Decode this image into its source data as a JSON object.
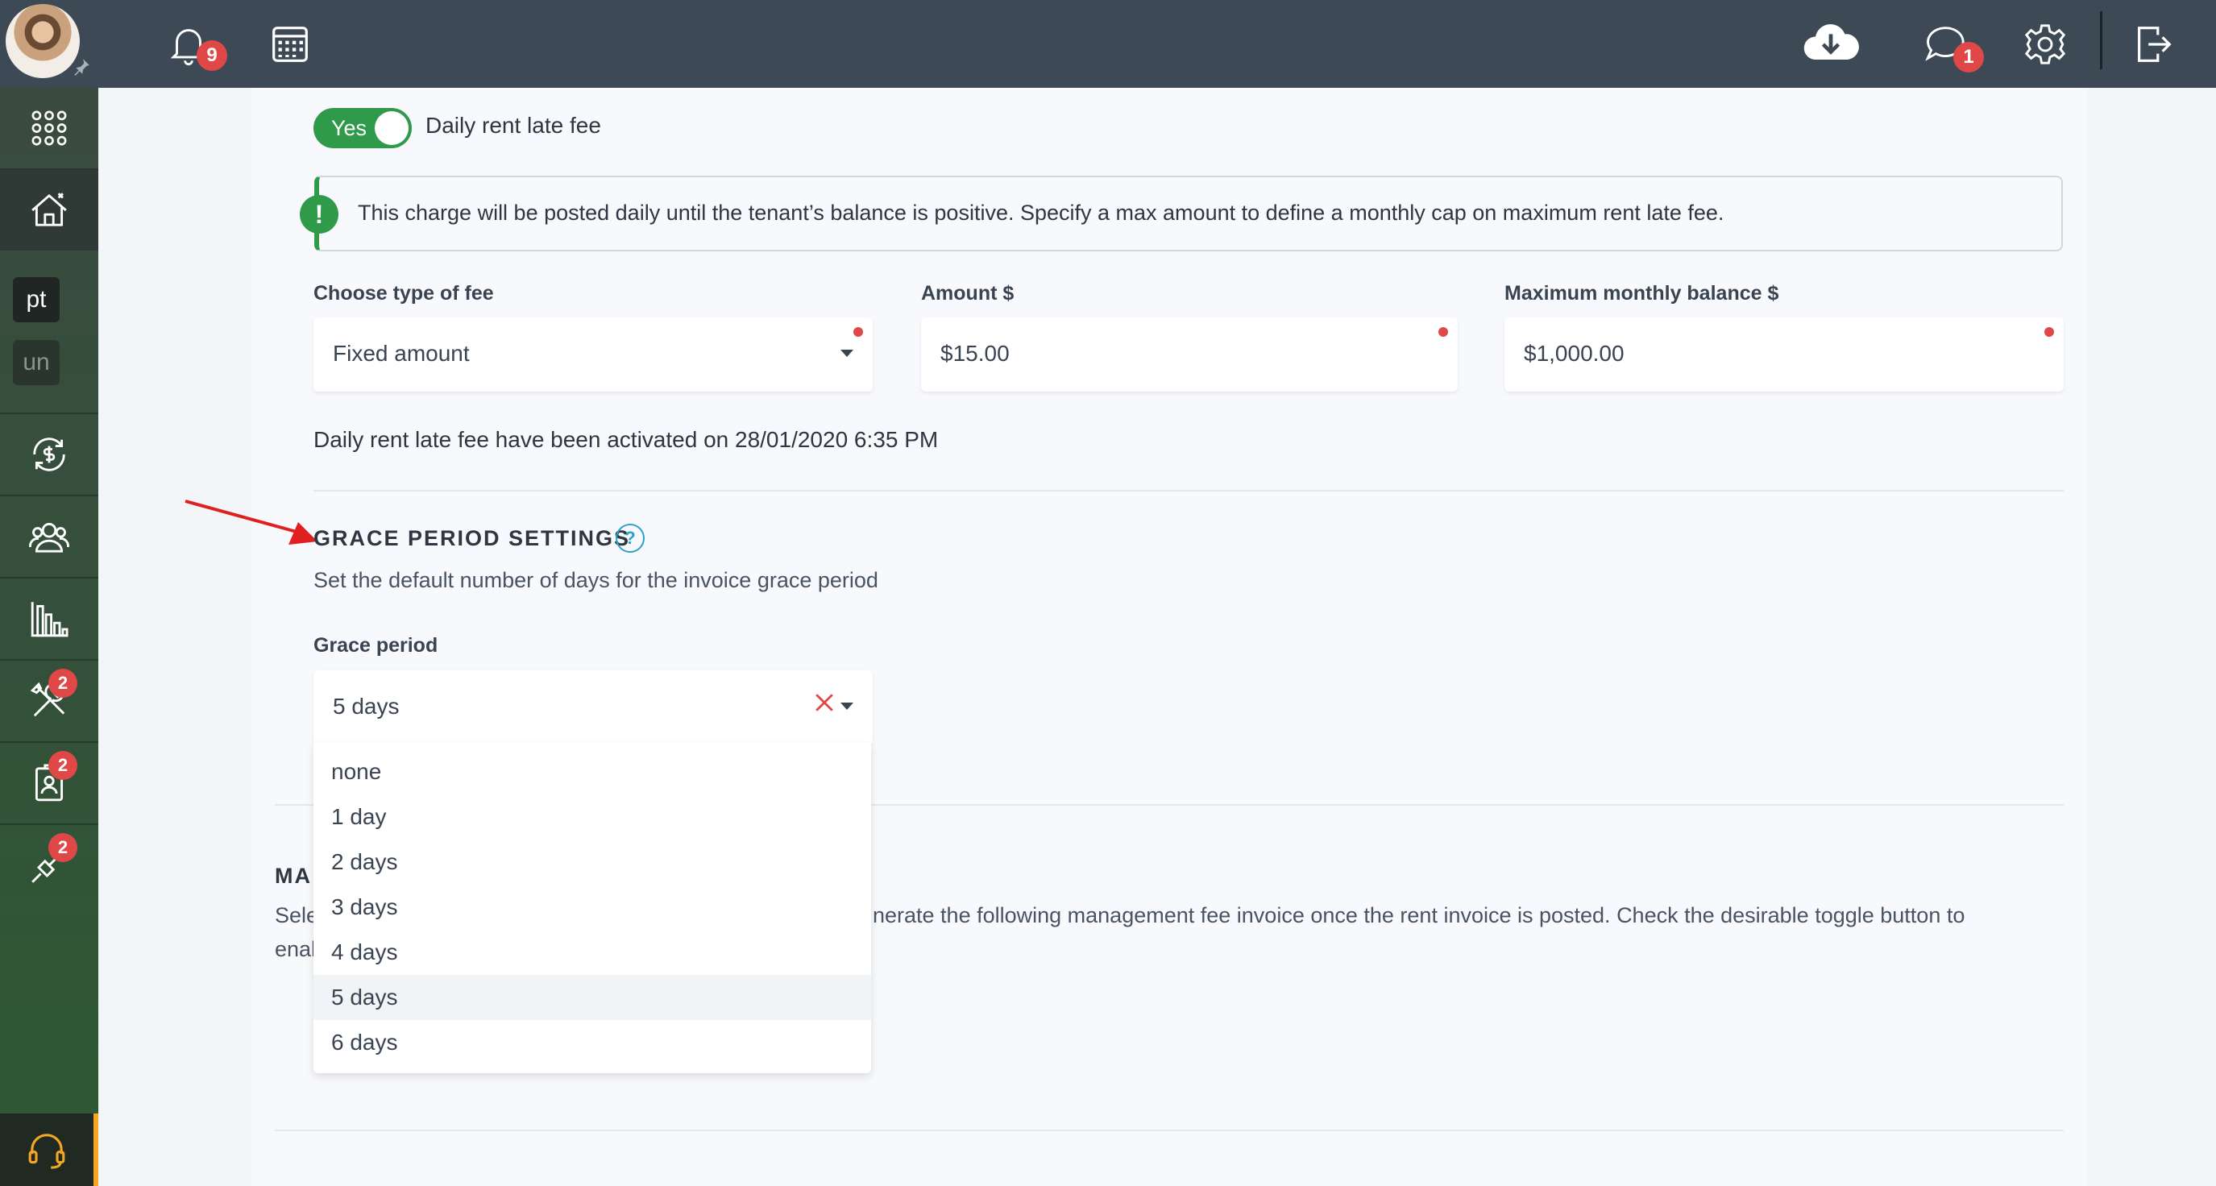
{
  "topbar": {
    "notifications_count": "9",
    "messages_count": "1"
  },
  "sidebar": {
    "text_items": [
      "pt",
      "un"
    ],
    "badges": {
      "tools": "2",
      "contacts": "2",
      "integrations": "2"
    }
  },
  "late_fee": {
    "toggle_label": "Yes",
    "title": "Daily rent late fee",
    "notice": "This charge will be posted daily until the tenant’s balance is positive. Specify a max amount to define a monthly cap on maximum rent late fee.",
    "fee_type_label": "Choose type of fee",
    "fee_type_value": "Fixed amount",
    "amount_label": "Amount $",
    "amount_value": "$15.00",
    "max_balance_label": "Maximum monthly balance $",
    "max_balance_value": "$1,000.00",
    "activated_text": "Daily rent late fee have been activated on 28/01/2020 6:35 PM"
  },
  "grace_period": {
    "section_title": "GRACE PERIOD SETTINGS",
    "help": "?",
    "description": "Set the default number of days for the invoice grace period",
    "field_label": "Grace period",
    "selected": "5 days",
    "options": [
      "none",
      "1 day",
      "2 days",
      "3 days",
      "4 days",
      "5 days",
      "6 days"
    ],
    "highlighted_index": 5
  },
  "management_fee": {
    "title_partial": "MA",
    "desc_line1_left": "Sele",
    "desc_line1_right": "nerate the following management fee invoice once the rent invoice is posted. Check the desirable toggle button to",
    "desc_line2_left": "enal"
  },
  "colors": {
    "topbar": "#3d4a55",
    "accent_green": "#2e9a4a",
    "badge_red": "#e04848",
    "help_blue": "#2aa3c7",
    "arrow_red": "#e02020"
  }
}
